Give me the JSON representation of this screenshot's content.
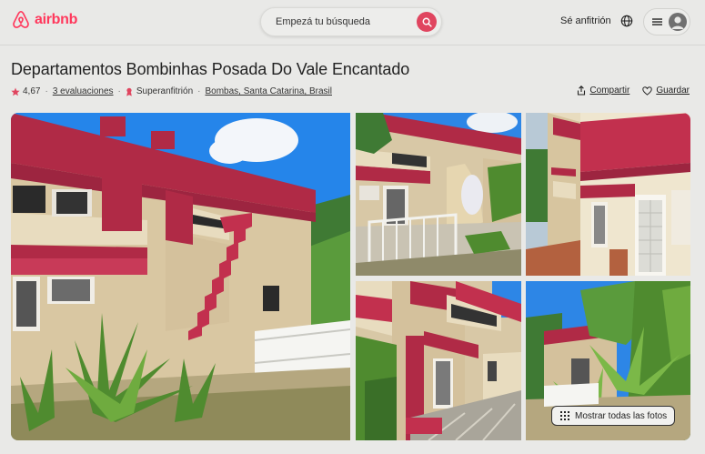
{
  "header": {
    "logo_text": "airbnb",
    "search_placeholder": "Empezá tu búsqueda",
    "host_link": "Sé anfitrión",
    "brand_color": "#ff385c"
  },
  "listing": {
    "title": "Departamentos Bombinhas Posada Do Vale Encantado",
    "rating": "4,67",
    "reviews": "3 evaluaciones",
    "host_badge": "Superanfitrión",
    "location": "Bombas, Santa Catarina, Brasil",
    "separator": "·",
    "share_label": "Compartir",
    "save_label": "Guardar"
  },
  "gallery": {
    "show_all_label": "Mostrar todas las fotos",
    "photos": [
      {
        "name": "photo-main",
        "subject": "building exterior with red roof"
      },
      {
        "name": "photo-2",
        "subject": "front gate and balconies"
      },
      {
        "name": "photo-3",
        "subject": "side corridor"
      },
      {
        "name": "photo-4",
        "subject": "stairway and entrance"
      },
      {
        "name": "photo-5",
        "subject": "garden with palms"
      }
    ]
  },
  "icons": [
    "airbnb-logo-icon",
    "search-icon",
    "globe-icon",
    "menu-icon",
    "avatar-icon",
    "star-icon",
    "superhost-icon",
    "share-icon",
    "heart-icon",
    "grid-icon"
  ]
}
